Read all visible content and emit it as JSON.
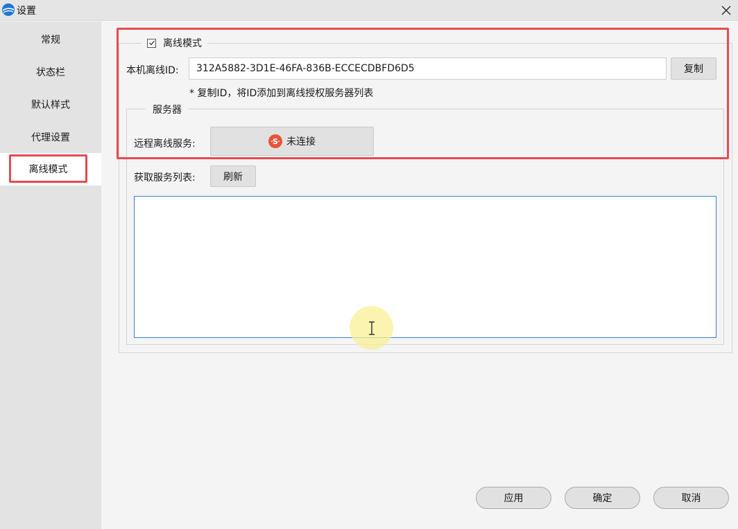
{
  "window": {
    "title": "设置"
  },
  "sidebar": {
    "items": [
      {
        "label": "常规"
      },
      {
        "label": "状态栏"
      },
      {
        "label": "默认样式"
      },
      {
        "label": "代理设置"
      },
      {
        "label": "离线模式"
      }
    ],
    "selected": "离线模式"
  },
  "offline": {
    "checkbox_label": "离线模式",
    "checked": true,
    "id_label": "本机离线ID:",
    "id_value": "312A5882-3D1E-46FA-836B-ECCECDBFD6D5",
    "copy_button": "复制",
    "hint": "* 复制ID，将ID添加到离线授权服务器列表"
  },
  "server": {
    "group_title": "服务器",
    "remote_label": "远程离线服务:",
    "status_button": "未连接",
    "status_icon": "disconnected-icon",
    "status_color": "#e6553a",
    "list_label": "获取服务列表:",
    "refresh_button": "刷新"
  },
  "footer": {
    "apply": "应用",
    "ok": "确定",
    "cancel": "取消"
  },
  "colors": {
    "highlight": "#e64a4f",
    "list_border": "#3c7fd6"
  }
}
